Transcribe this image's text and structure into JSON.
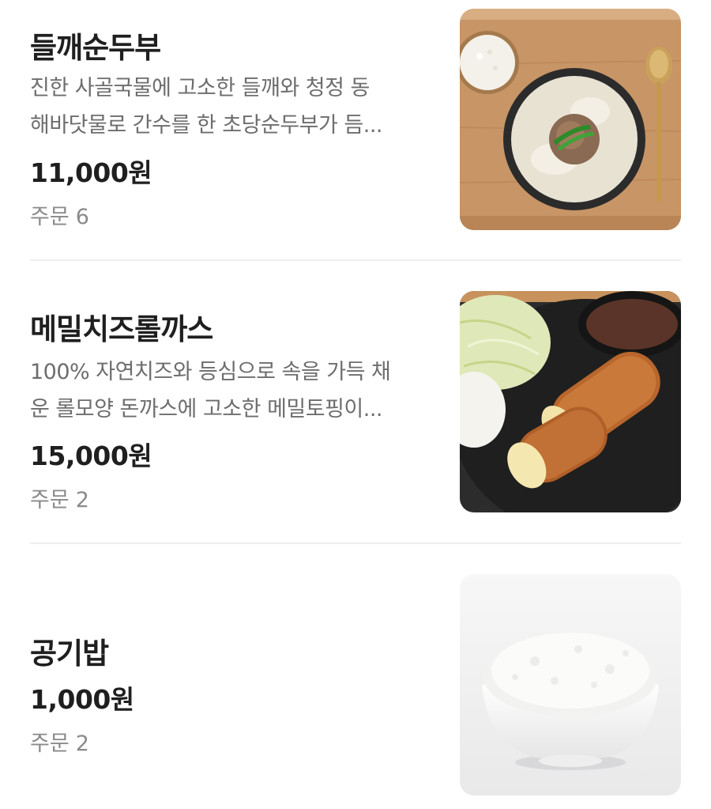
{
  "menu": {
    "order_label": "주문",
    "items": [
      {
        "name": "들깨순두부",
        "description_line1": "진한 사골국물에 고소한 들깨와 청정 동",
        "description_line2": "해바닷물로 간수를 한 초당순두부가 듬...",
        "price": "11,000원",
        "orders": "6",
        "image": "perilla-soft-tofu-soup-photo"
      },
      {
        "name": "메밀치즈롤까스",
        "description_line1": "100% 자연치즈와 등심으로 속을 가득 채",
        "description_line2": "운 롤모양 돈까스에 고소한 메밀토핑이...",
        "price": "15,000원",
        "orders": "2",
        "image": "buckwheat-cheese-roll-cutlet-photo"
      },
      {
        "name": "공기밥",
        "price": "1,000원",
        "orders": "2",
        "image": "bowl-of-rice-photo"
      }
    ]
  }
}
